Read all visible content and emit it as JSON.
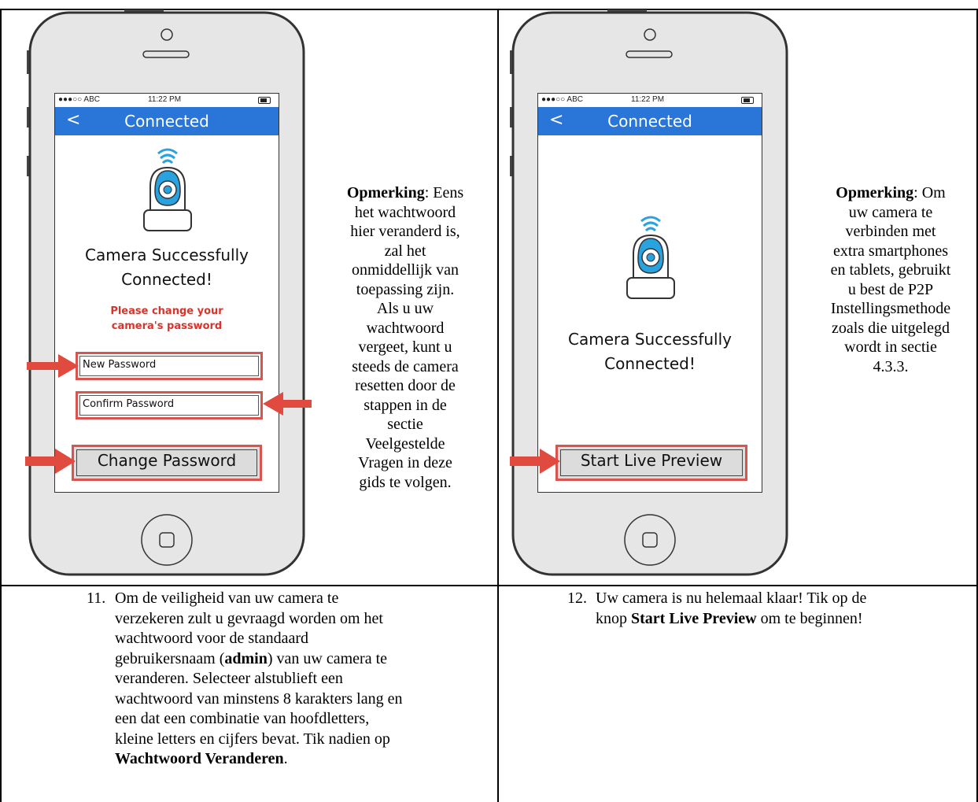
{
  "left_phone": {
    "status_carrier": "●●●○○ ABC",
    "status_time": "11:22 PM",
    "nav_back": "<",
    "nav_title": "Connected",
    "success_line1": "Camera Successfully",
    "success_line2": "Connected!",
    "password_msg_line1": "Please change your",
    "password_msg_line2": "camera's password",
    "new_password_placeholder": "New Password",
    "confirm_password_placeholder": "Confirm Password",
    "change_password_button": "Change Password"
  },
  "right_phone": {
    "status_carrier": "●●●○○ ABC",
    "status_time": "11:22 PM",
    "nav_back": "<",
    "nav_title": "Connected",
    "success_line1": "Camera Successfully",
    "success_line2": "Connected!",
    "start_button": "Start Live Preview"
  },
  "note_left": {
    "label": "Opmerking",
    "line1": ": Eens",
    "lines": [
      "het wachtwoord",
      "hier veranderd is,",
      "zal het",
      "onmiddellijk van",
      "toepassing zijn.",
      "Als u uw",
      "wachtwoord",
      "vergeet, kunt u",
      "steeds de camera",
      "resetten door de",
      "stappen in de",
      "sectie",
      "Veelgestelde",
      "Vragen in deze",
      "gids te volgen."
    ]
  },
  "note_right": {
    "label": "Opmerking",
    "line1": ": Om",
    "lines": [
      "uw camera te",
      "verbinden met",
      "extra smartphones",
      "en tablets, gebruikt",
      "u best de P2P",
      "Instellingsmethode",
      "zoals die uitgelegd",
      "wordt in sectie",
      "4.3.3."
    ]
  },
  "step11": {
    "number": "11.",
    "line1": "Om de veiligheid van uw camera te",
    "line2": "verzekeren zult u gevraagd worden om het",
    "line3": "wachtwoord voor de standaard",
    "line4_pre": "gebruikersnaam (",
    "line4_bold": "admin",
    "line4_post": ") van uw camera te",
    "line5": "veranderen. Selecteer alstublieft een",
    "line6": "wachtwoord van minstens 8 karakters lang en",
    "line7": "een dat een combinatie van hoofdletters,",
    "line8": "kleine letters en cijfers bevat. Tik nadien op",
    "line9_bold": "Wachtwoord Veranderen",
    "line9_post": "."
  },
  "step12": {
    "number": "12.",
    "line1": "Uw camera is nu helemaal klaar! Tik op de",
    "line2_pre": "knop ",
    "line2_bold": "Start Live Preview",
    "line2_post": " om te beginnen!"
  },
  "colors": {
    "nav_blue": "#2a76d8",
    "highlight_red": "#d9534f",
    "camera_blue": "#29a3e0"
  }
}
